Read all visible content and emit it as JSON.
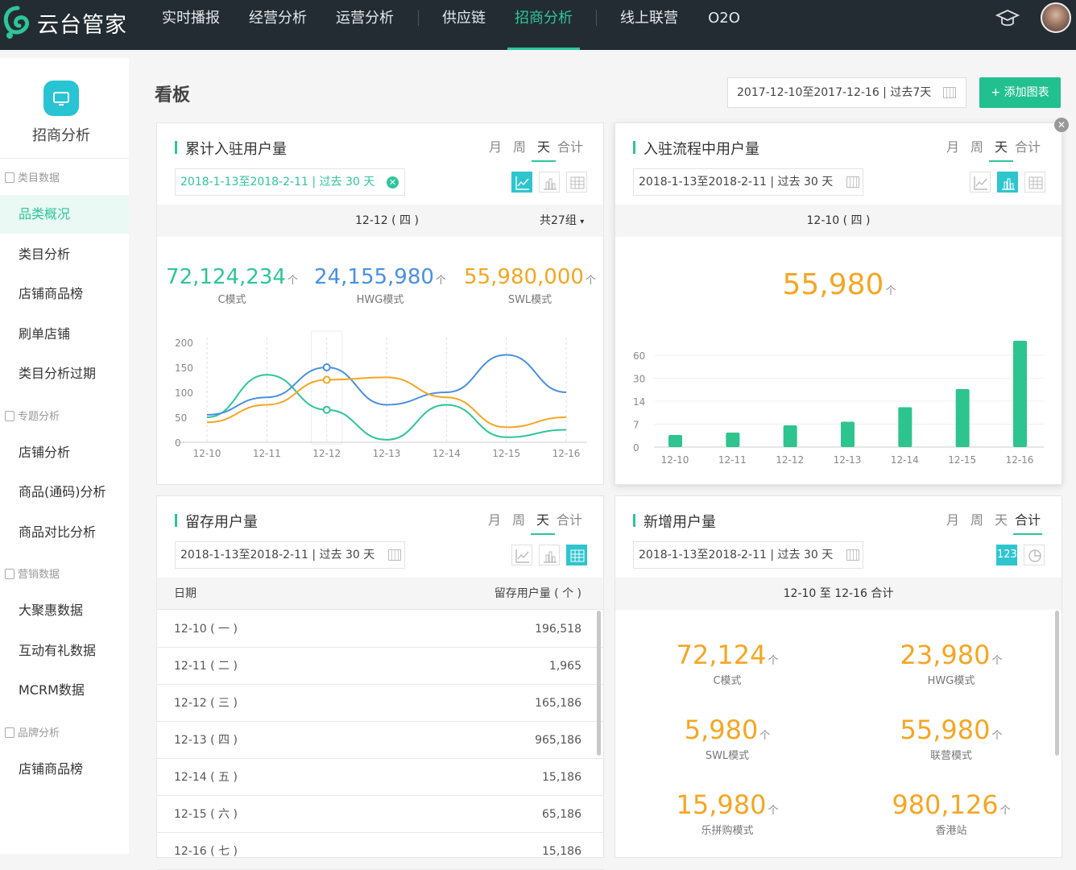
{
  "app": {
    "name": "云台管家"
  },
  "nav": {
    "items": [
      "实时播报",
      "经营分析",
      "运营分析",
      "供应链",
      "招商分析",
      "线上联营",
      "O2O"
    ],
    "active": "招商分析"
  },
  "sidebar": {
    "title": "招商分析",
    "groups": [
      {
        "label": "类目数据",
        "items": [
          "品类概况",
          "类目分析",
          "店铺商品榜",
          "刷单店铺",
          "类目分析过期"
        ]
      },
      {
        "label": "专题分析",
        "items": [
          "店铺分析",
          "商品(通码)分析",
          "商品对比分析"
        ]
      },
      {
        "label": "营销数据",
        "items": [
          "大聚惠数据",
          "互动有礼数据",
          "MCRM数据"
        ]
      },
      {
        "label": "品牌分析",
        "items": [
          "店铺商品榜"
        ]
      }
    ],
    "active_item": "品类概况"
  },
  "page": {
    "title": "看板",
    "date_range": "2017-12-10至2017-12-16 | 过去7天",
    "add_button": "+ 添加图表"
  },
  "tabs": {
    "month": "月",
    "week": "周",
    "day": "天",
    "total": "合计"
  },
  "card1": {
    "title": "累计入驻用户量",
    "active_tab": "天",
    "date_input": "2018-1-13至2018-2-11 | 过去 30 天",
    "band_date": "12-12 ( 四 )",
    "band_groups": "共27组",
    "kpis": [
      {
        "value": "72,124,234",
        "unit": "个",
        "label": "C模式",
        "color": "#2ec59a"
      },
      {
        "value": "24,155,980",
        "unit": "个",
        "label": "HWG模式",
        "color": "#4a90e2"
      },
      {
        "value": "55,980,000",
        "unit": "个",
        "label": "SWL模式",
        "color": "#f5a623"
      }
    ]
  },
  "card2": {
    "title": "入驻流程中用户量",
    "active_tab": "天",
    "date_input": "2018-1-13至2018-2-11 | 过去 30 天",
    "band_date": "12-10 ( 四 )",
    "kpi": {
      "value": "55,980",
      "unit": "个"
    }
  },
  "card3": {
    "title": "留存用户量",
    "active_tab": "天",
    "date_input": "2018-1-13至2018-2-11 | 过去 30 天",
    "columns": [
      "日期",
      "留存用户量 ( 个 )"
    ],
    "rows": [
      [
        "12-10 ( 一 )",
        "196,518"
      ],
      [
        "12-11 ( 二 )",
        "1,965"
      ],
      [
        "12-12 ( 三 )",
        "165,186"
      ],
      [
        "12-13 ( 四 )",
        "965,186"
      ],
      [
        "12-14 ( 五 )",
        "15,186"
      ],
      [
        "12-15 ( 六 )",
        "65,186"
      ],
      [
        "12-16 ( 七 )",
        "15,186"
      ]
    ]
  },
  "card4": {
    "title": "新增用户量",
    "active_tab": "合计",
    "date_input": "2018-1-13至2018-2-11 | 过去 30 天",
    "number_view_label": "123",
    "band": "12-10 至 12-16 合计",
    "kpis": [
      {
        "value": "72,124",
        "unit": "个",
        "label": "C模式"
      },
      {
        "value": "23,980",
        "unit": "个",
        "label": "HWG模式"
      },
      {
        "value": "5,980",
        "unit": "个",
        "label": "SWL模式"
      },
      {
        "value": "55,980",
        "unit": "个",
        "label": "联营模式"
      },
      {
        "value": "15,980",
        "unit": "个",
        "label": "乐拼购模式"
      },
      {
        "value": "980,126",
        "unit": "个",
        "label": "香港站"
      }
    ]
  },
  "chart_data": [
    {
      "type": "line",
      "x": [
        "12-10",
        "12-11",
        "12-12",
        "12-13",
        "12-14",
        "12-15",
        "12-16"
      ],
      "y_ticks": [
        0,
        50,
        100,
        150,
        200
      ],
      "ylim": [
        0,
        200
      ],
      "highlight_x": "12-12",
      "series": [
        {
          "name": "C模式",
          "color": "#2ec59a",
          "values": [
            50,
            135,
            65,
            5,
            75,
            10,
            25
          ]
        },
        {
          "name": "HWG模式",
          "color": "#4a90e2",
          "values": [
            55,
            90,
            150,
            75,
            100,
            175,
            100
          ]
        },
        {
          "name": "SWL模式",
          "color": "#f5a623",
          "values": [
            40,
            75,
            125,
            130,
            90,
            30,
            50
          ]
        }
      ]
    },
    {
      "type": "bar",
      "categories": [
        "12-10",
        "12-11",
        "12-12",
        "12-13",
        "12-14",
        "12-15",
        "12-16"
      ],
      "y_ticks": [
        "0",
        "7",
        "14",
        "30",
        "60"
      ],
      "values": [
        10,
        12,
        18,
        21,
        33,
        48,
        88
      ],
      "color": "#2ec48f"
    }
  ]
}
